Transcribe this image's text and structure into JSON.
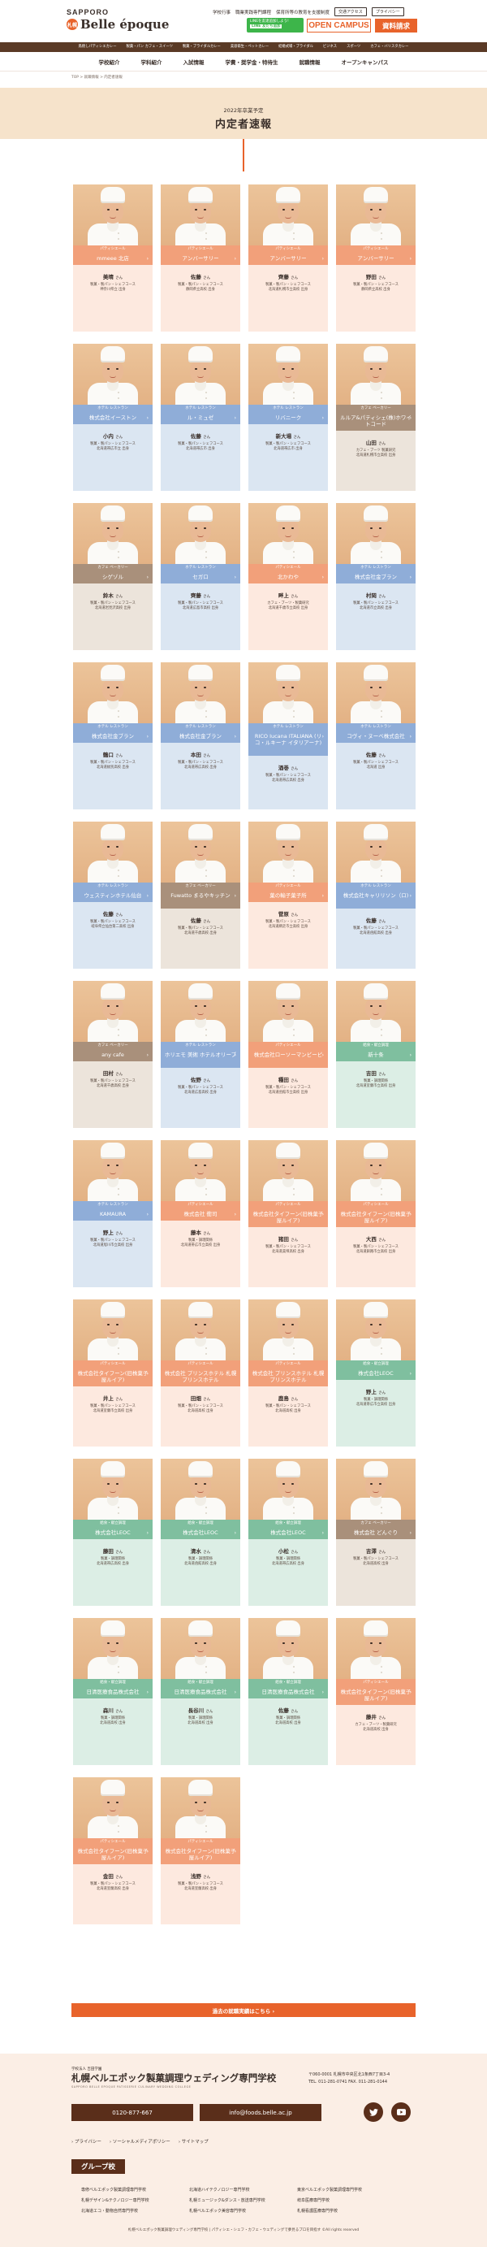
{
  "header": {
    "logo_small": "SAPPORO",
    "logo_badge": "札幌",
    "logo_text": "Belle époque",
    "top_links": [
      "学校行事",
      "職業実践専門課程",
      "保育所等の教育を支援制度"
    ],
    "top_buttons": [
      "交通アクセス",
      "プライバシー"
    ],
    "line_text_1": "LINEを友達追加しよう!",
    "line_text_2": "LINE 友だち追加",
    "open_campus": "OPEN CAMPUS",
    "doc_request": "資料請求"
  },
  "course_bar": [
    "鳥焼しパティシエカレー",
    "製菓・パン カフェ・スイーツ",
    "製菓・ブライダルカレー",
    "美容衛生・ペットカレー",
    "結婚式場・ブライダル",
    "ビジネス",
    "スポーツ",
    "カフェ・バリスタカレー",
    "エスコートホテル",
    "製菓大阪スイーツ",
    "ブライダル",
    "美容",
    "発酵・焼き"
  ],
  "main_nav": [
    "学校紹介",
    "学科紹介",
    "入試情報",
    "学費・奨学金・特待生",
    "就職情報",
    "オープンキャンパス"
  ],
  "breadcrumb": "TOP > 就職情報 > 内定者速報",
  "page": {
    "subtitle": "2022年卒業予定",
    "title": "内定者速報"
  },
  "san": "さん",
  "past_link": "過去の就職実績はこちら ›",
  "cards": [
    {
      "cat": "パティシエール",
      "company": "mmeee 北店",
      "name": "美晴",
      "lines": [
        "製菓・製パン・シェフコース",
        "神奈川県立 出身"
      ],
      "color": "orange"
    },
    {
      "cat": "パティシエール",
      "company": "アンバーサリー",
      "name": "佐藤",
      "lines": [
        "製菓・製パン・シェフコース",
        "静岡県立高校 出身"
      ],
      "color": "orange"
    },
    {
      "cat": "パティシエール",
      "company": "アンバーサリー",
      "name": "齊藤",
      "lines": [
        "製菓・製パン・シェフコース",
        "北海道札幌市立高校 出身"
      ],
      "color": "orange"
    },
    {
      "cat": "パティシエール",
      "company": "アンバーサリー",
      "name": "野田",
      "lines": [
        "製菓・製パン・シェフコース",
        "静岡県立高校 出身"
      ],
      "color": "orange"
    },
    {
      "cat": "ホテル レストラン",
      "company": "株式会社イーストン",
      "name": "小内",
      "lines": [
        "製菓・製パン・シェフコース",
        "北海道帯広市立 出身"
      ],
      "color": "blue"
    },
    {
      "cat": "ホテル レストラン",
      "company": "ル・ミュゼ",
      "name": "佐藤",
      "lines": [
        "製菓・製パン・シェフコース",
        "北海道帯広市 出身"
      ],
      "color": "blue"
    },
    {
      "cat": "ホテル レストラン",
      "company": "リバニーク",
      "name": "新大場",
      "lines": [
        "製菓・製パン・シェフコース",
        "北海道帯広市 出身"
      ],
      "color": "blue"
    },
    {
      "cat": "カフェ ベーカリー",
      "company": "ルルア&パティシェ(株)ホワイトコード",
      "name": "山田",
      "lines": [
        "カフェ・ブーツ 製菓研究",
        "北海道札幌市立高校 出身"
      ],
      "color": "brown"
    },
    {
      "cat": "カフェ ベーカリー",
      "company": "シゲゾル",
      "name": "鈴木",
      "lines": [
        "製菓・製パン・シェフコース",
        "北海道岩見沢高校 出身"
      ],
      "color": "brown"
    },
    {
      "cat": "ホテル レストラン",
      "company": "セガロ",
      "name": "齊藤",
      "lines": [
        "製菓・製パン・シェフコース",
        "北海道広島市高校 出身"
      ],
      "color": "blue"
    },
    {
      "cat": "パティシエール",
      "company": "北かわや",
      "name": "畔上",
      "lines": [
        "カフェ・ブーツ・製菓研究",
        "北海道千歳市立高校 出身"
      ],
      "color": "orange"
    },
    {
      "cat": "ホテル レストラン",
      "company": "株式会社金ブラン",
      "name": "村岡",
      "lines": [
        "製菓・製パン・シェフコース",
        "北海道市立高校 出身"
      ],
      "color": "blue"
    },
    {
      "cat": "ホテル レストラン",
      "company": "株式会社金ブラン",
      "name": "鶴口",
      "lines": [
        "製菓・製パン・シェフコース",
        "北海道紋別高校 出身"
      ],
      "color": "blue"
    },
    {
      "cat": "ホテル レストラン",
      "company": "株式会社金ブラン",
      "name": "本田",
      "lines": [
        "製菓・製パン・シェフコース",
        "北海道帯広高校 出身"
      ],
      "color": "blue"
    },
    {
      "cat": "ホテル レストラン",
      "company": "RICO Iucana ITALIANA (リコ・ルキーナ イタリアーナ)",
      "name": "酒巻",
      "lines": [
        "製菓・製パン・シェフコース",
        "北海道帯広高校 出身"
      ],
      "color": "blue"
    },
    {
      "cat": "ホテル レストラン",
      "company": "コヴィ・ヌーベ株式会社",
      "name": "佐藤",
      "lines": [
        "製菓・製パン・シェフコース",
        "北海道 出身"
      ],
      "color": "blue"
    },
    {
      "cat": "ホテル レストラン",
      "company": "ウェスティンホテル仙台",
      "name": "佐藤",
      "lines": [
        "製菓・製パン・シェフコース",
        "岐阜県立仙台第二高校 出身"
      ],
      "color": "blue"
    },
    {
      "cat": "カフェ ベーカリー",
      "company": "Fuwatto まるやキッチン",
      "name": "佐藤",
      "lines": [
        "製菓・製パン・シェフコース",
        "北海道千歳高校 出身"
      ],
      "color": "brown"
    },
    {
      "cat": "パティシエール",
      "company": "菓の輸子菓子所",
      "name": "菅原",
      "lines": [
        "製菓・製パン・シェフコース",
        "北海道網走市立高校 出身"
      ],
      "color": "orange"
    },
    {
      "cat": "ホテル レストラン",
      "company": "株式会社キャリリソン（ロ)",
      "name": "佐藤",
      "lines": [
        "製菓・製パン・シェフコース",
        "北海道函館高校 出身"
      ],
      "color": "blue"
    },
    {
      "cat": "カフェ ベーカリー",
      "company": "any cafe",
      "name": "田村",
      "lines": [
        "製菓・製パン・シェフコース",
        "北海道千歳高校 出身"
      ],
      "color": "brown"
    },
    {
      "cat": "ホテル レストラン",
      "company": "ホリエモ 美術 ホテルオリーブ",
      "name": "佐野",
      "lines": [
        "製菓・製パン・シェフコース",
        "北海道広島高校 出身"
      ],
      "color": "blue"
    },
    {
      "cat": "パティシエール",
      "company": "株式会社ローソーマンビーピ",
      "name": "種田",
      "lines": [
        "製菓・製パン・シェフコース",
        "北海道函館市立高校 出身"
      ],
      "color": "orange"
    },
    {
      "cat": "給食・献立調理",
      "company": "新十条",
      "name": "吉田",
      "lines": [
        "製菓・調理関係",
        "北海道室蘭市立高校 出身"
      ],
      "color": "green"
    },
    {
      "cat": "ホテル レストラン",
      "company": "KAMAURA",
      "name": "野上",
      "lines": [
        "製菓・製パン・シェフコース",
        "北海道旭川市立高校 出身"
      ],
      "color": "blue"
    },
    {
      "cat": "パティシエール",
      "company": "株式会社 衝司",
      "name": "藤本",
      "lines": [
        "製菓・調理関係",
        "北海道帯広市立高校 出身"
      ],
      "color": "orange"
    },
    {
      "cat": "パティシエール",
      "company": "株式会社タイフーン(旧株菓子屋ルイア)",
      "name": "猪田",
      "lines": [
        "製菓・製パン・シェフコース",
        "北海道美唄高校 出身"
      ],
      "color": "orange"
    },
    {
      "cat": "パティシエール",
      "company": "株式会社タイフーン(旧株菓子屋ルイア)",
      "name": "大西",
      "lines": [
        "製菓・製パン・シェフコース",
        "北海道釧路市立高校 出身"
      ],
      "color": "orange"
    },
    {
      "cat": "パティシエール",
      "company": "株式会社タイフーン(旧株菓子屋ルイア)",
      "name": "井上",
      "lines": [
        "製菓・製パン・シェフコース",
        "北海道室蘭市立高校 出身"
      ],
      "color": "orange"
    },
    {
      "cat": "パティシエール",
      "company": "株式会社 プリンスホテル 札幌プリンスホテル",
      "name": "田畑",
      "lines": [
        "製菓・製パン・シェフコース",
        "北海道高校 出身"
      ],
      "color": "orange"
    },
    {
      "cat": "パティシエール",
      "company": "株式会社 プリンスホテル 札幌プリンスホテル",
      "name": "鹿島",
      "lines": [
        "製菓・製パン・シェフコース",
        "北海道高校 出身"
      ],
      "color": "orange"
    },
    {
      "cat": "給食・献立調理",
      "company": "株式会社LEOC",
      "name": "野上",
      "lines": [
        "製菓・調理関係",
        "北海道帯広市立高校 出身"
      ],
      "color": "green"
    },
    {
      "cat": "給食・献立調理",
      "company": "株式会社LEOC",
      "name": "藤田",
      "lines": [
        "製菓・調理関係",
        "北海道帯広高校 出身"
      ],
      "color": "green"
    },
    {
      "cat": "給食・献立調理",
      "company": "株式会社LEOC",
      "name": "清水",
      "lines": [
        "製菓・調理関係",
        "北海道函館高校 出身"
      ],
      "color": "green"
    },
    {
      "cat": "給食・献立調理",
      "company": "株式会社LEOC",
      "name": "小松",
      "lines": [
        "製菓・調理関係",
        "北海道帯広高校 出身"
      ],
      "color": "green"
    },
    {
      "cat": "カフェ ベーカリー",
      "company": "株式会社 どんぐり",
      "name": "吉澤",
      "lines": [
        "製菓・製パン・シェフコース",
        "北海道高校 出身"
      ],
      "color": "brown"
    },
    {
      "cat": "給食・献立調理",
      "company": "日清医療食品株式会社",
      "name": "森川",
      "lines": [
        "製菓・調理関係",
        "北海道高校 出身"
      ],
      "color": "green"
    },
    {
      "cat": "給食・献立調理",
      "company": "日清医療食品株式会社",
      "name": "長谷川",
      "lines": [
        "製菓・調理関係",
        "北海道高校 出身"
      ],
      "color": "green"
    },
    {
      "cat": "給食・献立調理",
      "company": "日清医療食品株式会社",
      "name": "佐藤",
      "lines": [
        "製菓・調理関係",
        "北海道高校 出身"
      ],
      "color": "green"
    },
    {
      "cat": "パティシエール",
      "company": "株式会社タイフーン(旧株菓子屋ルイア)",
      "name": "藤井",
      "lines": [
        "カフェ・ブーツ・製菓研究",
        "北海道高校 出身"
      ],
      "color": "orange"
    },
    {
      "cat": "パティシエール",
      "company": "株式会社タイフーン(旧株菓子屋ルイア)",
      "name": "金田",
      "lines": [
        "製菓・製パン・シェフコース",
        "北海道室蘭高校 出身"
      ],
      "color": "orange"
    },
    {
      "cat": "パティシエール",
      "company": "株式会社タイフーン(旧株菓子屋ルイア)",
      "name": "浅野",
      "lines": [
        "製菓・製パン・シェフコース",
        "北海道室蘭高校 出身"
      ],
      "color": "orange"
    }
  ],
  "footer": {
    "school_small": "学校法人 吉田学園",
    "school_name": "札幌ベルエポック製菓調理ウェディング専門学校",
    "school_en": "SAPPORO BELLE EPOQUE PATISSERIE CULINARY WEDDING COLLEGE",
    "address": [
      "〒060-0001 札幌市中央区北1条西7丁目3-4",
      "TEL. 011-281-0741 FAX. 011-281-0144"
    ],
    "tel": "0120-877-667",
    "mail": "info@foods.belle.ac.jp",
    "links": [
      "› プライバシー",
      "› ソーシャルメディアポリシー",
      "› サイトマップ"
    ],
    "group_title": "グループ校",
    "group_schools": [
      "専修ベルエポック製菓調理専門学校",
      "北海道ハイテクノロジー専門学校",
      "東京ベルエポック製菓調理専門学校",
      "札幌デザイン&テクノロジー専門学校",
      "札幌ミュージック&ダンス・放送専門学校",
      "岐阜医療専門学校",
      "北海道エコ・動物自然専門学校",
      "札幌ベルエポック美容専門学校",
      "札幌看護医療専門学校"
    ],
    "copyright": "札幌ベルエポック製菓調理ウェディング専門学校 | パティシエ・シェフ・カフェ・ウェディングで夢見るプロを目指す ©All rights reserved"
  }
}
